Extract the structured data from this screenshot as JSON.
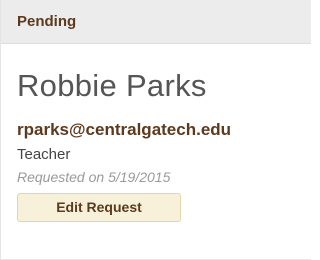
{
  "card": {
    "status": "Pending",
    "name": "Robbie Parks",
    "email": "rparks@centralgatech.edu",
    "role": "Teacher",
    "requested": "Requested on 5/19/2015",
    "edit_button_label": "Edit Request"
  }
}
